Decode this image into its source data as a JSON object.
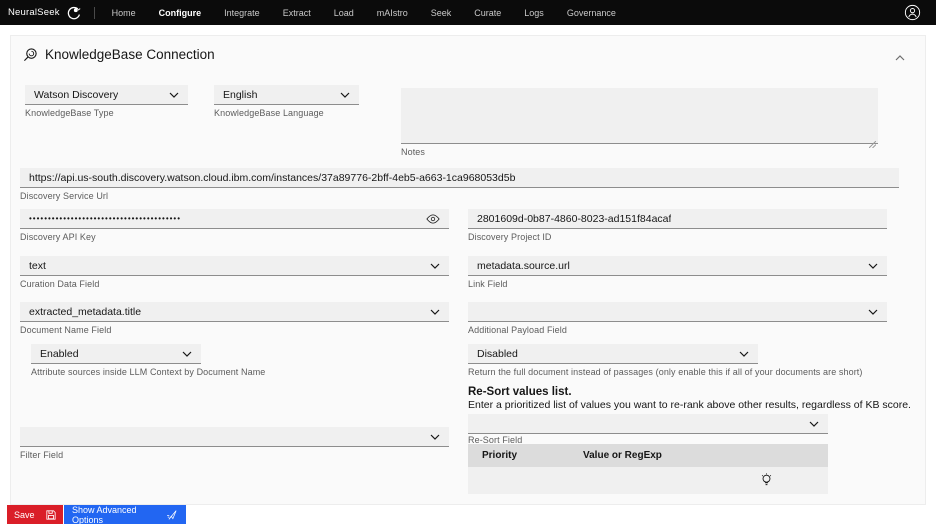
{
  "colors": {
    "navbar_bg": "#0b0b0b",
    "save_red": "#da1e28",
    "advanced_blue": "#2266f2",
    "field_underline": "#8d8d8d",
    "table_header_bg": "#dcdcdc"
  },
  "navbar": {
    "brand": "NeuralSeek",
    "items": [
      {
        "label": "Home"
      },
      {
        "label": "Configure"
      },
      {
        "label": "Integrate"
      },
      {
        "label": "Extract"
      },
      {
        "label": "Load"
      },
      {
        "label": "mAIstro"
      },
      {
        "label": "Seek"
      },
      {
        "label": "Curate"
      },
      {
        "label": "Logs"
      },
      {
        "label": "Governance"
      }
    ]
  },
  "panel": {
    "title": "KnowledgeBase Connection"
  },
  "form": {
    "kb_type": {
      "value": "Watson Discovery",
      "label": "KnowledgeBase Type"
    },
    "kb_language": {
      "value": "English",
      "label": "KnowledgeBase Language"
    },
    "notes": {
      "value": "",
      "label": "Notes"
    },
    "service_url": {
      "value": "https://api.us-south.discovery.watson.cloud.ibm.com/instances/37a89776-2bff-4eb5-a663-1ca968053d5b",
      "label": "Discovery Service Url"
    },
    "api_key": {
      "value": "••••••••••••••••••••••••••••••••••••••••",
      "label": "Discovery API Key"
    },
    "project_id": {
      "value": "2801609d-0b87-4860-8023-ad151f84acaf",
      "label": "Discovery Project ID"
    },
    "curation_data_field": {
      "value": "text",
      "label": "Curation Data Field"
    },
    "link_field": {
      "value": "metadata.source.url",
      "label": "Link Field"
    },
    "document_name_field": {
      "value": "extracted_metadata.title",
      "label": "Document Name Field"
    },
    "additional_payload_field": {
      "value": "",
      "label": "Additional Payload Field"
    },
    "attribute_sources": {
      "value": "Enabled",
      "label": "Attribute sources inside LLM Context by Document Name"
    },
    "full_document_return": {
      "value": "Disabled",
      "label": "Return the full document instead of passages (only enable this if all of your documents are short)"
    },
    "resort": {
      "title": "Re-Sort values list.",
      "description": "Enter a prioritized list of values you want to re-rank above other results, regardless of KB score.",
      "field_value": "",
      "field_label": "Re-Sort Field",
      "columns": [
        "Priority",
        "Value or RegExp"
      ]
    },
    "filter_field": {
      "value": "",
      "label": "Filter Field"
    }
  },
  "footer": {
    "save_label": "Save",
    "advanced_label": "Show Advanced Options"
  }
}
